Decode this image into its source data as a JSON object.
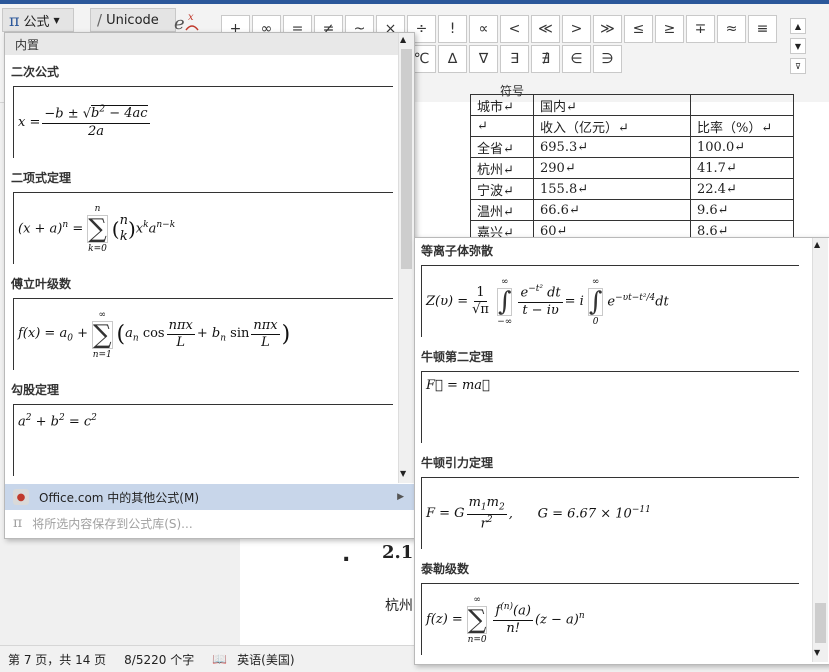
{
  "ribbon": {
    "equation_label": "公式",
    "unicode_label": "Unicode",
    "group_label": "符号",
    "symbols_row1": [
      "+",
      "∞",
      "=",
      "≠",
      "~",
      "×",
      "÷",
      "!",
      "∝",
      "<",
      "≪",
      ">",
      "≫",
      "≤",
      "≥",
      "∓",
      "≈",
      "≡"
    ],
    "symbols_row2": [
      "∪",
      "∩",
      "∅",
      "%",
      "∘",
      "℉",
      "℃",
      "∆",
      "∇",
      "∃",
      "∄",
      "∈",
      "∋"
    ]
  },
  "gallery": {
    "section_label": "内置",
    "items": [
      {
        "title": "二次公式"
      },
      {
        "title": "二项式定理"
      },
      {
        "title": "傅立叶级数"
      },
      {
        "title": "勾股定理"
      }
    ],
    "more_label": "Office.com 中的其他公式(M)",
    "save_label": "将所选内容保存到公式库(S)..."
  },
  "more_panel": {
    "items": [
      {
        "title": "等离子体弥散"
      },
      {
        "title": "牛顿第二定理"
      },
      {
        "title": "牛顿引力定理"
      },
      {
        "title": "泰勒级数"
      }
    ]
  },
  "document": {
    "table": {
      "rows": [
        [
          "城市↵",
          "国内↵",
          ""
        ],
        [
          "↵",
          "收入（亿元）↵",
          "比率（%）↵"
        ],
        [
          "全省↵",
          "695.3↵",
          "100.0↵"
        ],
        [
          "杭州↵",
          "290↵",
          "41.7↵"
        ],
        [
          "宁波↵",
          "155.8↵",
          "22.4↵"
        ],
        [
          "温州↵",
          "66.6↵",
          "9.6↵"
        ],
        [
          "嘉兴↵",
          "60↵",
          "8.6↵"
        ]
      ]
    },
    "heading": "2.1",
    "body_text": "杭州"
  },
  "status": {
    "page": "第 7 页，共 14 页",
    "words": "8/5220 个字",
    "language": "英语(美国)"
  },
  "colors": {
    "accent": "#2b579a",
    "highlight": "#c8d6ea"
  }
}
